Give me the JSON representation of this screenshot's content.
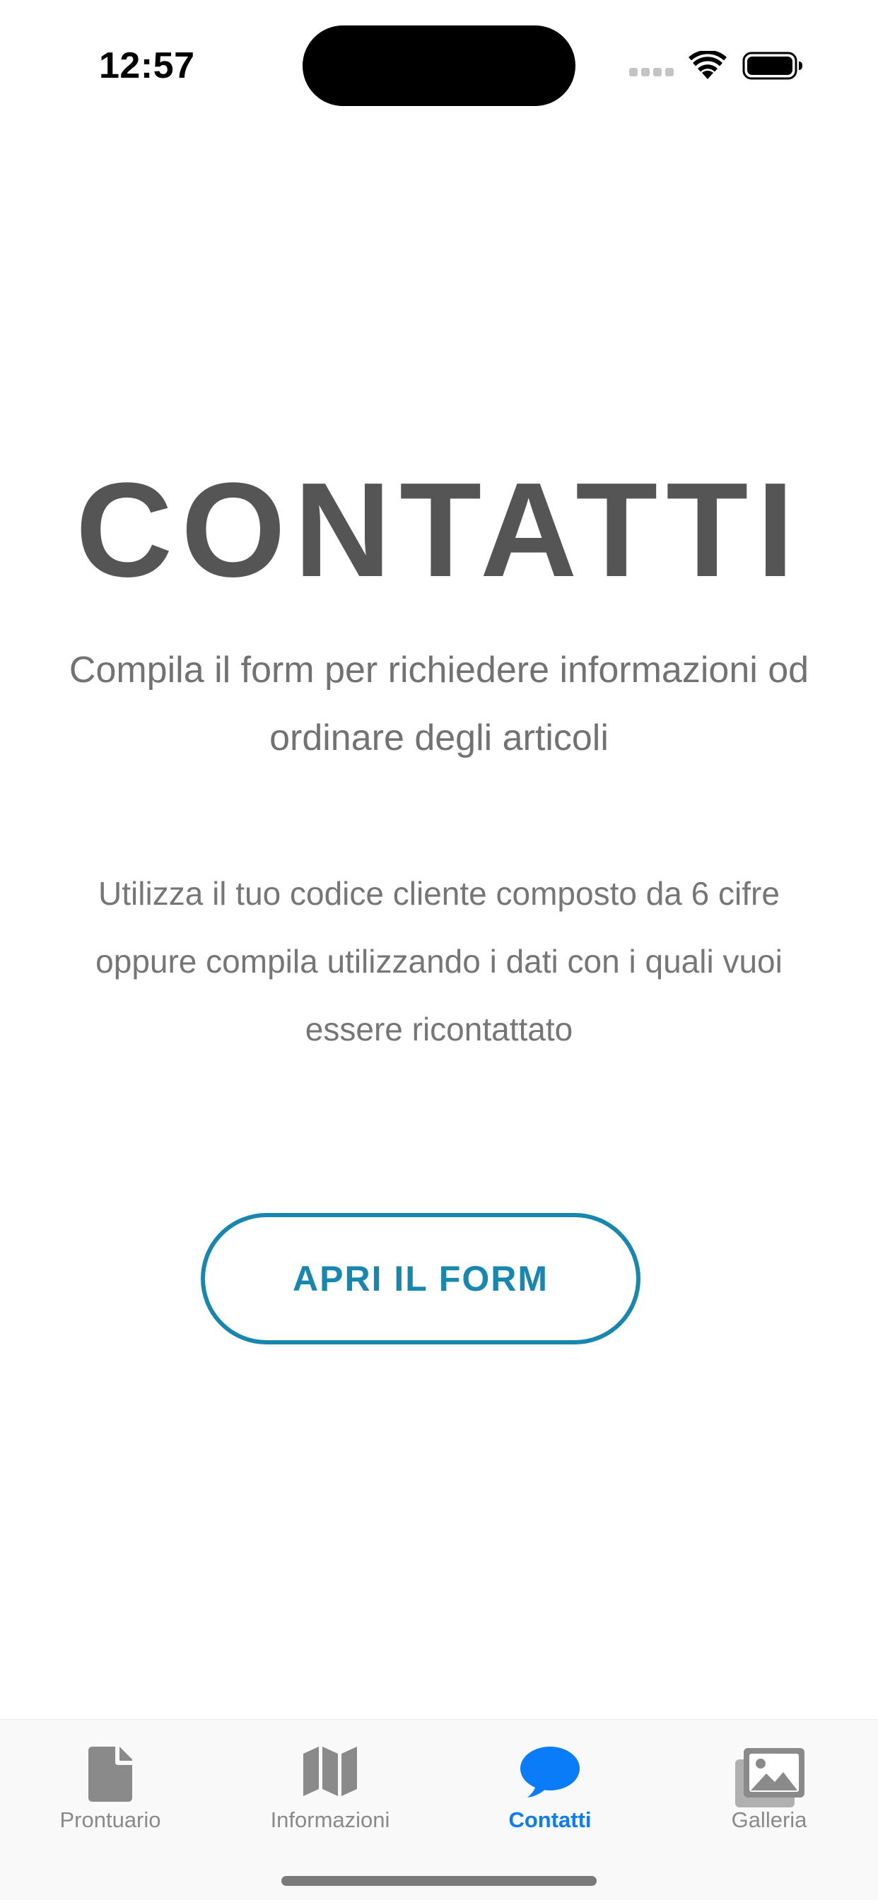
{
  "status_bar": {
    "time": "12:57"
  },
  "main": {
    "title": "CONTATTI",
    "subtitle": "Compila il form per richiedere informazioni od ordinare degli articoli",
    "description": "Utilizza il tuo codice cliente composto da 6 cifre oppure compila utilizzando i dati con i quali vuoi essere ricontattato",
    "open_form_label": "APRI IL FORM"
  },
  "tab_bar": {
    "items": [
      {
        "label": "Prontuario",
        "icon": "document-icon",
        "active": false
      },
      {
        "label": "Informazioni",
        "icon": "map-icon",
        "active": false
      },
      {
        "label": "Contatti",
        "icon": "chat-bubble-icon",
        "active": true
      },
      {
        "label": "Galleria",
        "icon": "gallery-icon",
        "active": false
      }
    ]
  },
  "colors": {
    "accent": "#1787b0",
    "active_tab": "#0a7cf7",
    "inactive_tab": "#8a8a8a",
    "title": "#555555",
    "body_text": "#727272"
  }
}
